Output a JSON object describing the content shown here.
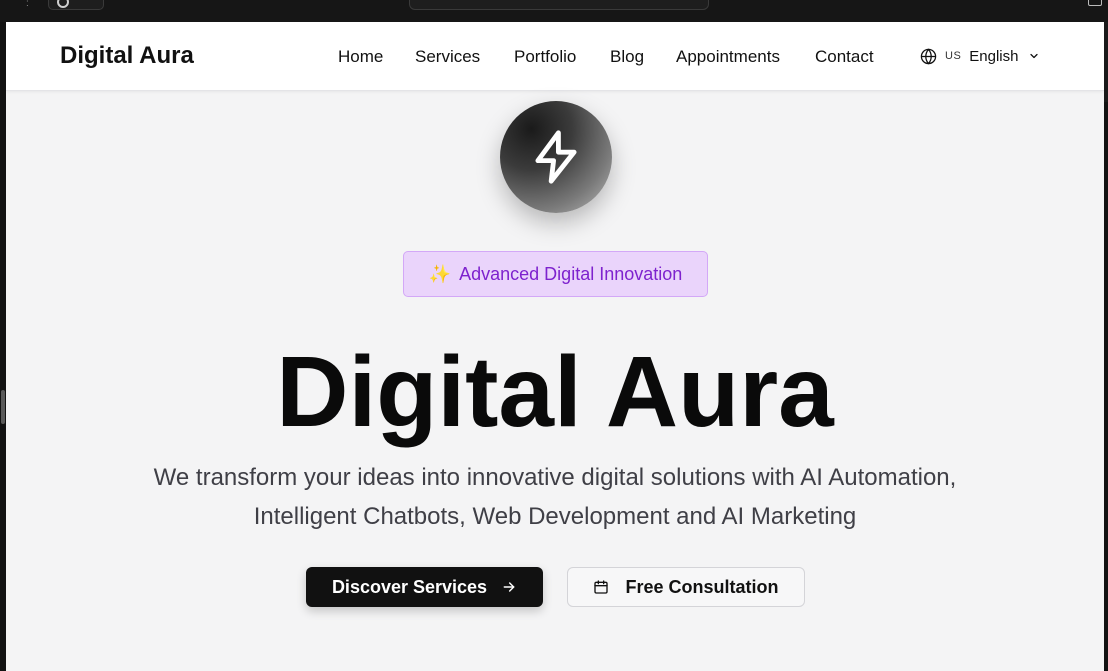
{
  "site": {
    "logo": "Digital Aura"
  },
  "nav": {
    "items": [
      {
        "label": "Home"
      },
      {
        "label": "Services"
      },
      {
        "label": "Portfolio"
      },
      {
        "label": "Blog"
      },
      {
        "label": "Appointments"
      },
      {
        "label": "Contact"
      }
    ]
  },
  "language": {
    "code": "US",
    "label": "English",
    "icon": "globe-icon"
  },
  "hero": {
    "icon": "lightning-bolt-icon",
    "badge": {
      "emoji": "✨",
      "text": "Advanced Digital Innovation"
    },
    "title": "Digital Aura",
    "subtitle_line1": "We transform your ideas into innovative digital solutions with AI Automation,",
    "subtitle_line2": "Intelligent Chatbots, Web Development and AI Marketing",
    "primary_button": "Discover Services",
    "secondary_button": "Free Consultation"
  },
  "colors": {
    "badge_bg": "#ead4fb",
    "badge_text": "#7e22ce",
    "primary_bg": "#111111",
    "page_bg": "#f4f4f5"
  }
}
